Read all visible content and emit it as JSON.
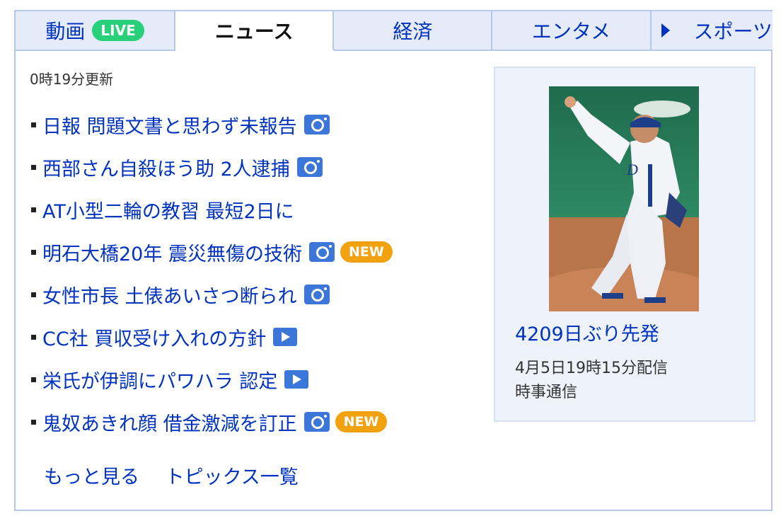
{
  "tabs": [
    {
      "label": "動画",
      "badge": "LIVE",
      "active": false
    },
    {
      "label": "ニュース",
      "active": true
    },
    {
      "label": "経済",
      "active": false
    },
    {
      "label": "エンタメ",
      "active": false
    },
    {
      "label": "スポーツ",
      "active": false
    }
  ],
  "updated": "0時19分更新",
  "news": [
    {
      "title": "日報 問題文書と思わず未報告",
      "icon": "camera-icon",
      "new": ""
    },
    {
      "title": "西部さん自殺ほう助 2人逮捕",
      "icon": "camera-icon",
      "new": ""
    },
    {
      "title": "AT小型二輪の教習 最短2日に",
      "icon": "",
      "new": ""
    },
    {
      "title": "明石大橋20年 震災無傷の技術",
      "icon": "camera-icon",
      "new": "NEW"
    },
    {
      "title": "女性市長 土俵あいさつ断られ",
      "icon": "camera-icon",
      "new": ""
    },
    {
      "title": "CC社 買収受け入れの方針",
      "icon": "video-icon",
      "new": ""
    },
    {
      "title": "栄氏が伊調にパワハラ 認定",
      "icon": "video-icon",
      "new": ""
    },
    {
      "title": "鬼奴あきれ顔 借金激減を訂正",
      "icon": "camera-icon",
      "new": "NEW"
    }
  ],
  "footer": {
    "more": "もっと見る",
    "topics": "トピックス一覧"
  },
  "feature": {
    "title": "4209日ぶり先発",
    "date": "4月5日19時15分配信",
    "source": "時事通信"
  },
  "colors": {
    "link": "#0033bf",
    "live": "#27d079",
    "new": "#f2a10f",
    "tab_bg": "#e6ebf9",
    "border": "#b7c7e6"
  }
}
